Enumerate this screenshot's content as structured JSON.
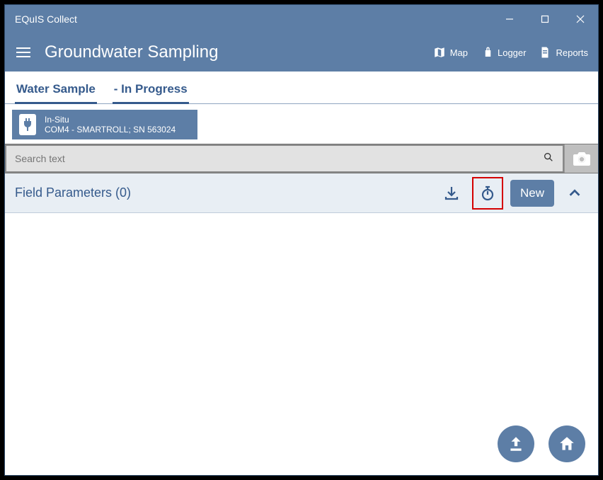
{
  "titlebar": {
    "title": "EQuIS Collect"
  },
  "header": {
    "page_title": "Groundwater Sampling",
    "actions": {
      "map": "Map",
      "logger": "Logger",
      "reports": "Reports"
    }
  },
  "tabs": {
    "t1": "Water Sample",
    "t2": "- In Progress"
  },
  "device": {
    "name": "In-Situ",
    "detail": "COM4 - SMARTROLL; SN 563024"
  },
  "search": {
    "placeholder": "Search text"
  },
  "section": {
    "title": "Field Parameters (0)",
    "new_label": "New"
  }
}
